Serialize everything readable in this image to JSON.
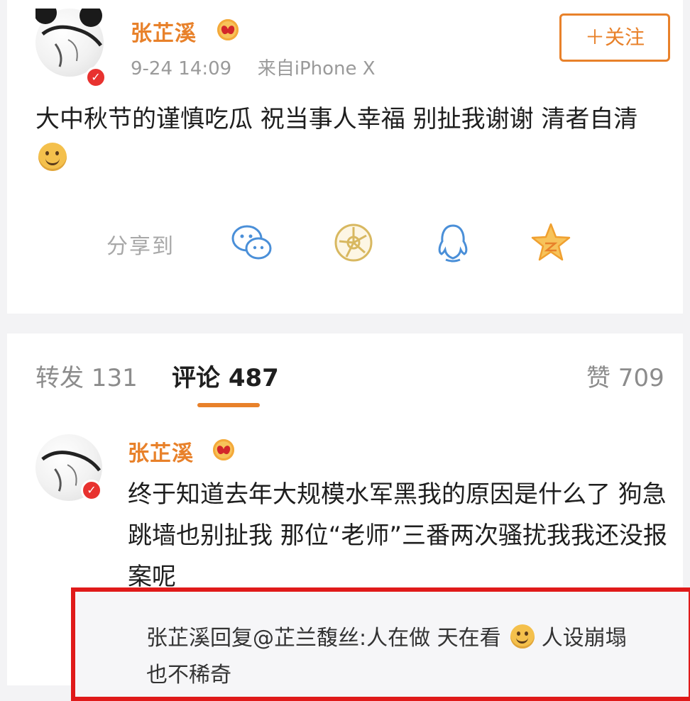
{
  "post": {
    "username": "张芷溪",
    "time": "9-24 14:09",
    "source": "来自iPhone X",
    "follow_label": "＋关注",
    "text": "大中秋节的谨慎吃瓜 祝当事人幸福 别扯我谢谢 清者自清",
    "emoji": "smile-emoji",
    "share_label": "分享到",
    "share_icons": [
      "wechat-icon",
      "moments-icon",
      "qq-icon",
      "qzone-icon"
    ]
  },
  "tabs": {
    "repost": "转发 131",
    "comment": "评论 487",
    "like": "赞 709"
  },
  "comment": {
    "username": "张芷溪",
    "text": "终于知道去年大规模水军黑我的原因是什么了 狗急跳墙也别扯我 那位“老师”三番两次骚扰我我还没报案呢"
  },
  "reply": {
    "author": "张芷溪",
    "verb": "回复",
    "mention": "@芷兰馥丝",
    "separator": ":",
    "text_before_emoji": "人在做 天在看",
    "text_after_emoji": "人设崩塌也不稀奇"
  },
  "colors": {
    "accent_orange": "#e8812a",
    "verified_red": "#e8322f",
    "highlight_box": "#e01a1a"
  }
}
